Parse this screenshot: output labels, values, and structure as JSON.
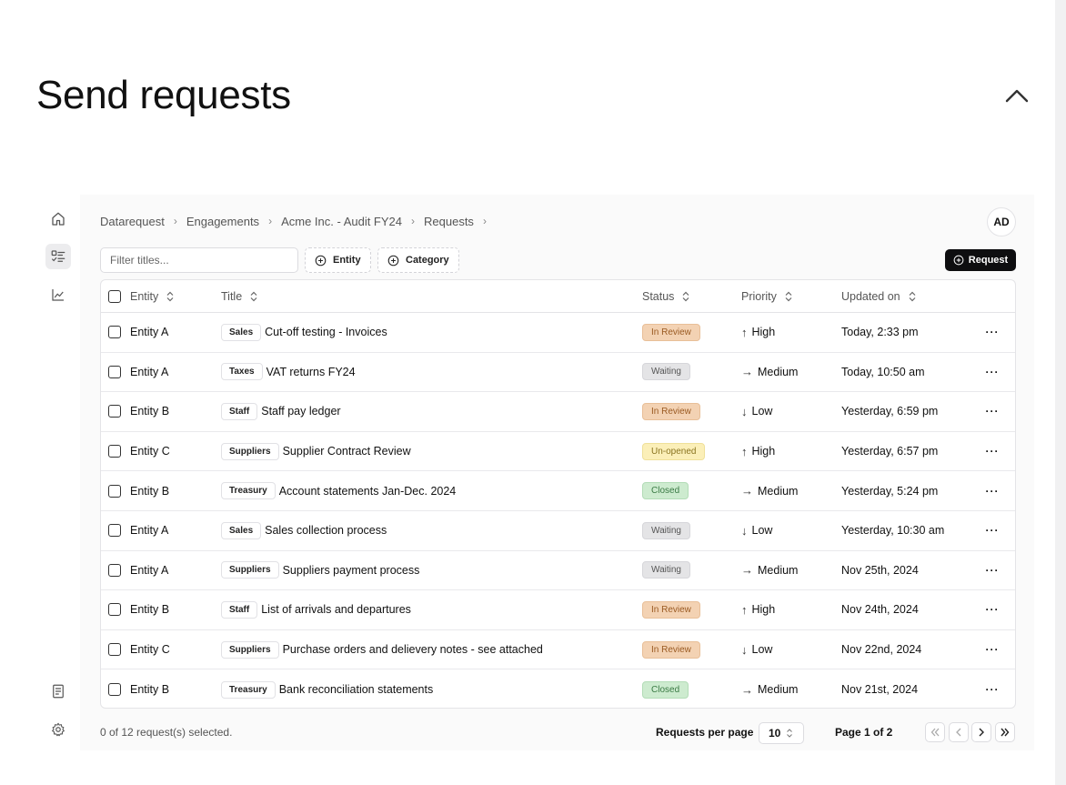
{
  "page": {
    "heading": "Send requests"
  },
  "breadcrumb": [
    {
      "label": "Datarequest"
    },
    {
      "label": "Engagements"
    },
    {
      "label": "Acme Inc. - Audit FY24"
    },
    {
      "label": "Requests"
    }
  ],
  "user": {
    "initials": "AD"
  },
  "toolbar": {
    "filter_placeholder": "Filter titles...",
    "entity_label": "Entity",
    "category_label": "Category",
    "request_label": "Request"
  },
  "table": {
    "headers": {
      "entity": "Entity",
      "title": "Title",
      "status": "Status",
      "priority": "Priority",
      "updated": "Updated on"
    },
    "rows": [
      {
        "entity": "Entity A",
        "tag": "Sales",
        "title": "Cut-off testing - Invoices",
        "status": "In Review",
        "status_kind": "review",
        "priority_arrow": "↑",
        "priority": "High",
        "updated": "Today, 2:33 pm"
      },
      {
        "entity": "Entity A",
        "tag": "Taxes",
        "title": "VAT returns FY24",
        "status": "Waiting",
        "status_kind": "waiting",
        "priority_arrow": "→",
        "priority": "Medium",
        "updated": "Today, 10:50 am"
      },
      {
        "entity": "Entity B",
        "tag": "Staff",
        "title": "Staff pay ledger",
        "status": "In Review",
        "status_kind": "review",
        "priority_arrow": "↓",
        "priority": "Low",
        "updated": "Yesterday, 6:59 pm"
      },
      {
        "entity": "Entity C",
        "tag": "Suppliers",
        "title": "Supplier Contract Review",
        "status": "Un-opened",
        "status_kind": "unopened",
        "priority_arrow": "↑",
        "priority": "High",
        "updated": "Yesterday, 6:57 pm"
      },
      {
        "entity": "Entity B",
        "tag": "Treasury",
        "title": "Account statements Jan-Dec. 2024",
        "status": "Closed",
        "status_kind": "closed",
        "priority_arrow": "→",
        "priority": "Medium",
        "updated": "Yesterday, 5:24 pm"
      },
      {
        "entity": "Entity A",
        "tag": "Sales",
        "title": "Sales collection process",
        "status": "Waiting",
        "status_kind": "waiting",
        "priority_arrow": "↓",
        "priority": "Low",
        "updated": "Yesterday, 10:30 am"
      },
      {
        "entity": "Entity A",
        "tag": "Suppliers",
        "title": "Suppliers payment process",
        "status": "Waiting",
        "status_kind": "waiting",
        "priority_arrow": "→",
        "priority": "Medium",
        "updated": "Nov 25th, 2024"
      },
      {
        "entity": "Entity B",
        "tag": "Staff",
        "title": "List of arrivals and departures",
        "status": "In Review",
        "status_kind": "review",
        "priority_arrow": "↑",
        "priority": "High",
        "updated": "Nov 24th, 2024"
      },
      {
        "entity": "Entity C",
        "tag": "Suppliers",
        "title": "Purchase orders and delievery notes - see attached",
        "status": "In Review",
        "status_kind": "review",
        "priority_arrow": "↓",
        "priority": "Low",
        "updated": "Nov 22nd, 2024"
      },
      {
        "entity": "Entity B",
        "tag": "Treasury",
        "title": "Bank reconciliation statements",
        "status": "Closed",
        "status_kind": "closed",
        "priority_arrow": "→",
        "priority": "Medium",
        "updated": "Nov 21st, 2024"
      }
    ],
    "row_actions": "···"
  },
  "footer": {
    "selection": "0 of 12 request(s) selected.",
    "per_page_label": "Requests per page",
    "per_page_value": "10",
    "page_info": "Page 1 of 2"
  },
  "icons": {
    "sidebar": [
      "home-icon",
      "list-checks-icon",
      "line-chart-icon",
      "book-icon",
      "gear-icon"
    ],
    "collapse": "chevron-up-icon",
    "pagination": [
      "chevrons-left-icon",
      "chevron-left-icon",
      "chevron-right-icon",
      "chevrons-right-icon"
    ]
  }
}
